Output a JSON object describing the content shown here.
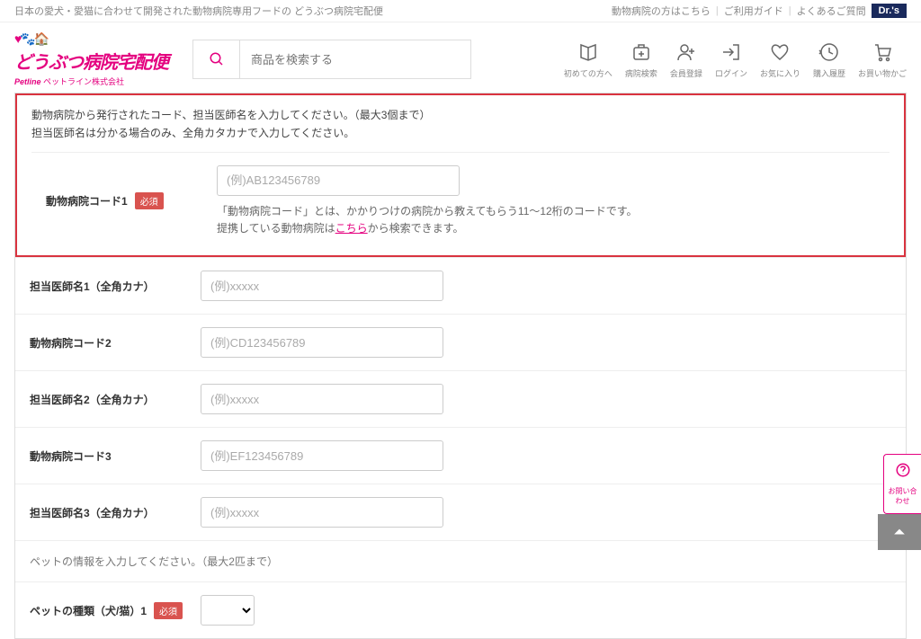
{
  "topbar": {
    "tagline": "日本の愛犬・愛猫に合わせて開発された動物病院専用フードの どうぶつ病院宅配便",
    "links": {
      "vet": "動物病院の方はこちら",
      "guide": "ご利用ガイド",
      "faq": "よくあるご質問"
    },
    "drs": "Dr.'s"
  },
  "logo": {
    "main": "どうぶつ病院宅配便",
    "sub_brand": "Petline",
    "sub_company": "ペットライン株式会社"
  },
  "search": {
    "placeholder": "商品を検索する"
  },
  "header_icons": {
    "first_time": "初めての方へ",
    "hospital_search": "病院検索",
    "register": "会員登録",
    "login": "ログイン",
    "favorite": "お気に入り",
    "history": "購入履歴",
    "cart": "お買い物かご"
  },
  "form": {
    "intro_line1": "動物病院から発行されたコード、担当医師名を入力してください。（最大3個まで）",
    "intro_line2": "担当医師名は分かる場合のみ、全角カタカナで入力してください。",
    "required_label": "必須",
    "fields": {
      "code1": {
        "label": "動物病院コード1",
        "placeholder": "(例)AB123456789"
      },
      "doctor1": {
        "label": "担当医師名1（全角カナ）",
        "placeholder": "(例)xxxxx"
      },
      "code2": {
        "label": "動物病院コード2",
        "placeholder": "(例)CD123456789"
      },
      "doctor2": {
        "label": "担当医師名2（全角カナ）",
        "placeholder": "(例)xxxxx"
      },
      "code3": {
        "label": "動物病院コード3",
        "placeholder": "(例)EF123456789"
      },
      "doctor3": {
        "label": "担当医師名3（全角カナ）",
        "placeholder": "(例)xxxxx"
      },
      "pet_type1": {
        "label": "ペットの種類（犬/猫）1"
      }
    },
    "help": {
      "part1": "「動物病院コード」とは、かかりつけの病院から教えてもらう11～12桁のコードです。",
      "part2_a": "提携している動物病院は",
      "part2_link": "こちら",
      "part2_b": "から検索できます。"
    },
    "pet_section": "ペットの情報を入力してください。（最大2匹まで）"
  },
  "float": {
    "label": "お問い合わせ"
  }
}
